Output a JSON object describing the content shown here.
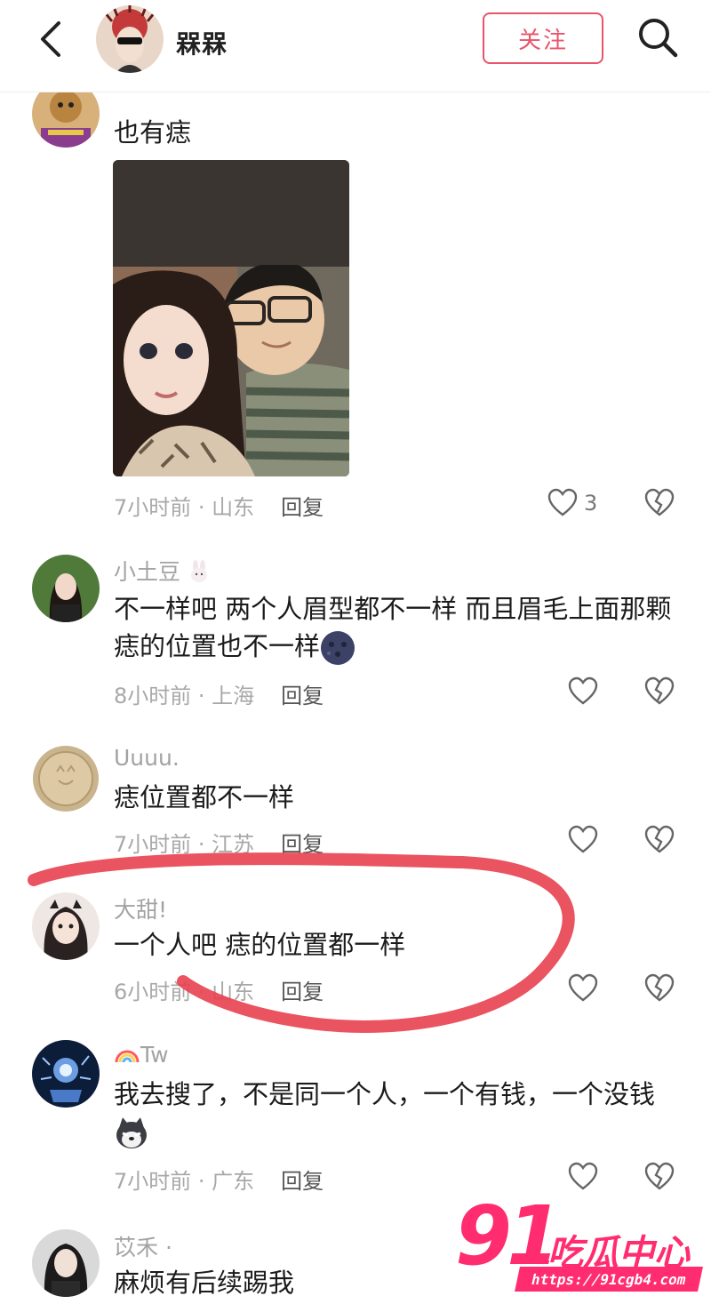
{
  "header": {
    "name": "槑槑",
    "follow_label": "关注"
  },
  "comments": [
    {
      "username": "",
      "text": "也有痣",
      "time": "7小时前 · 山东",
      "reply": "回复",
      "likes": "3"
    },
    {
      "username": "小土豆",
      "text": "不一样吧 两个人眉型都不一样 而且眉毛上面那颗痣的位置也不一样",
      "time": "8小时前 · 上海",
      "reply": "回复"
    },
    {
      "username": "Uuuu.",
      "text": "痣位置都不一样",
      "time": "7小时前 · 江苏",
      "reply": "回复"
    },
    {
      "username": "大甜!",
      "text": "一个人吧  痣的位置都一样",
      "time": "6小时前 · 山东",
      "reply": "回复"
    },
    {
      "username": "Tw",
      "text": "我去搜了，不是同一个人，一个有钱，一个没钱",
      "time": "7小时前 · 广东",
      "reply": "回复"
    },
    {
      "username": "苡禾 ·",
      "text": "麻烦有后续踢我",
      "time": "",
      "reply": ""
    }
  ],
  "watermark": {
    "number": "91",
    "brand": "吃瓜中心",
    "url": "https://91cgb4.com"
  },
  "colors": {
    "accent": "#e9546b",
    "annotation": "#e8404f",
    "watermark": "#ff2d6f"
  }
}
